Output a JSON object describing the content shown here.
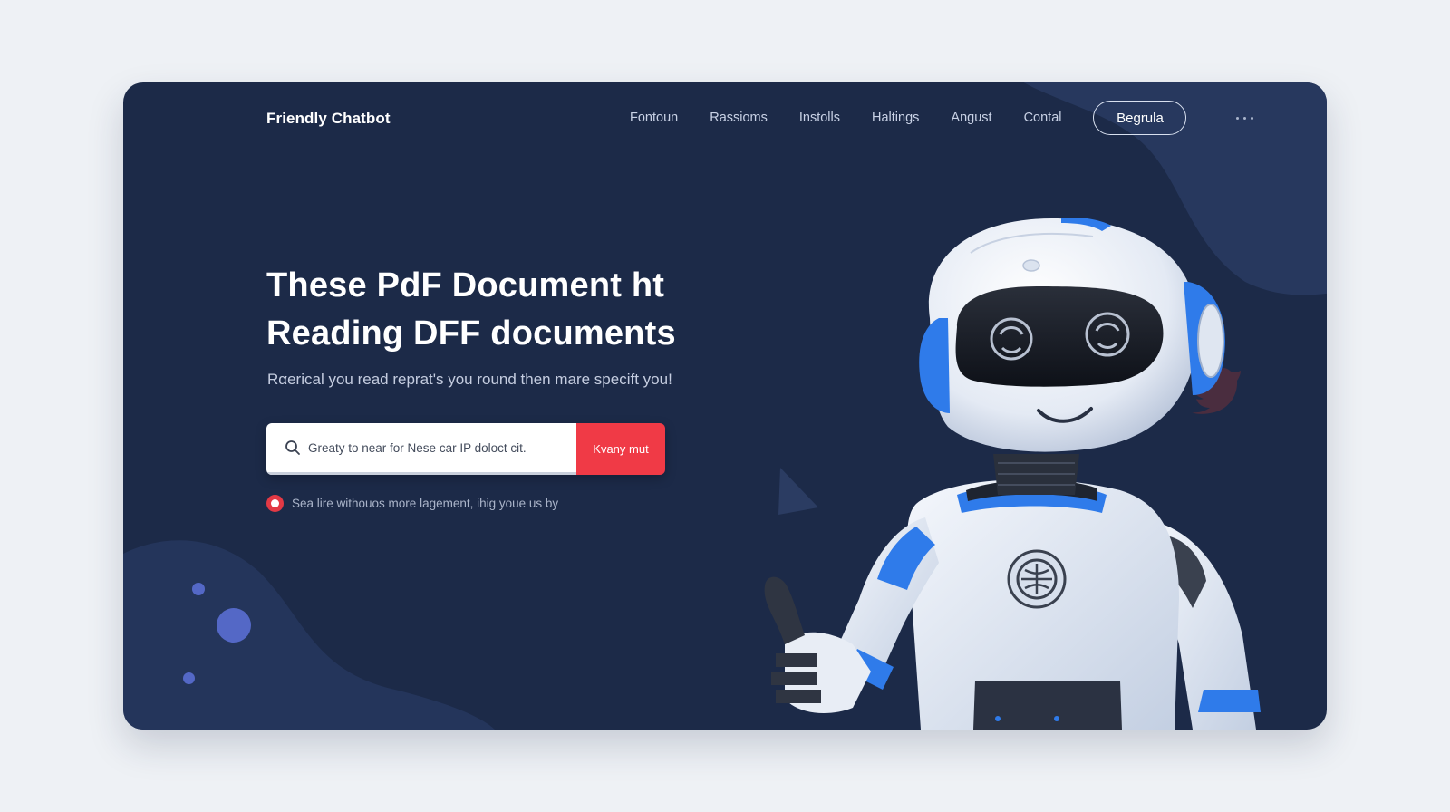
{
  "brand": "Friendly Chatbot",
  "nav": {
    "links": [
      "Fontoun",
      "Rassioms",
      "Instolls",
      "Haltings",
      "Angust",
      "Contal"
    ],
    "cta": "Begrula"
  },
  "hero": {
    "headline_line1": "These PdF Document ht",
    "headline_line2": "Reading DFF documents",
    "subtitle": "Rαerical you read reprat's you round then mare specift you!"
  },
  "search": {
    "placeholder": "Greaty to near for Nese car IP doloct cit.",
    "button": "Kvany mut"
  },
  "note": "Sea lire withouos more lagement, ihig youe us by",
  "colors": {
    "background": "#1c2a48",
    "accent_red": "#f03a46",
    "robot_blue": "#2f7bea",
    "page": "#eef1f5"
  },
  "icons": [
    "search-icon",
    "more-dots-icon",
    "radio-selected-icon",
    "robot-illustration",
    "bird-icon",
    "triangle-shape"
  ]
}
